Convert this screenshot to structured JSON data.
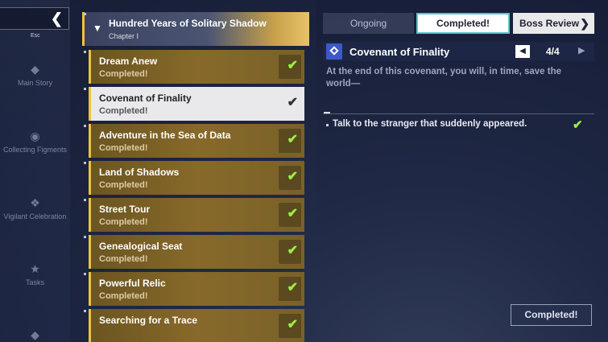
{
  "nav": {
    "back_label": "‹",
    "esc_label": "Esc",
    "items": [
      {
        "label": "Main Story",
        "icon": "main-story-icon"
      },
      {
        "label": "Collecting Figments",
        "icon": "figments-icon"
      },
      {
        "label": "Vigilant Celebration",
        "icon": "celebration-icon"
      },
      {
        "label": "Tasks",
        "icon": "star-icon"
      }
    ]
  },
  "chapter": {
    "title": "Hundred Years of Solitary Shadow",
    "subtitle": "Chapter I"
  },
  "quests": [
    {
      "name": "Dream Anew",
      "status": "Completed!"
    },
    {
      "name": "Covenant of Finality",
      "status": "Completed!",
      "selected": true
    },
    {
      "name": "Adventure in the Sea of Data",
      "status": "Completed!"
    },
    {
      "name": "Land of Shadows",
      "status": "Completed!"
    },
    {
      "name": "Street Tour",
      "status": "Completed!"
    },
    {
      "name": "Genealogical Seat",
      "status": "Completed!"
    },
    {
      "name": "Powerful Relic",
      "status": "Completed!"
    },
    {
      "name": "Searching for a Trace",
      "status": ""
    }
  ],
  "tabs": {
    "ongoing": "Ongoing",
    "completed": "Completed!",
    "boss_review": "Boss Review"
  },
  "detail": {
    "title": "Covenant of Finality",
    "page": "4/4",
    "description": "At the end of this covenant, you will, in time, save the world—",
    "objective": "Talk to the stranger that suddenly appeared."
  },
  "footer": {
    "completed_button": "Completed!"
  },
  "colors": {
    "accent_gold": "#f0c23a",
    "check_green": "#9cf045",
    "tab_border": "#59c6c8",
    "quest_icon_blue": "#3d58c9"
  }
}
